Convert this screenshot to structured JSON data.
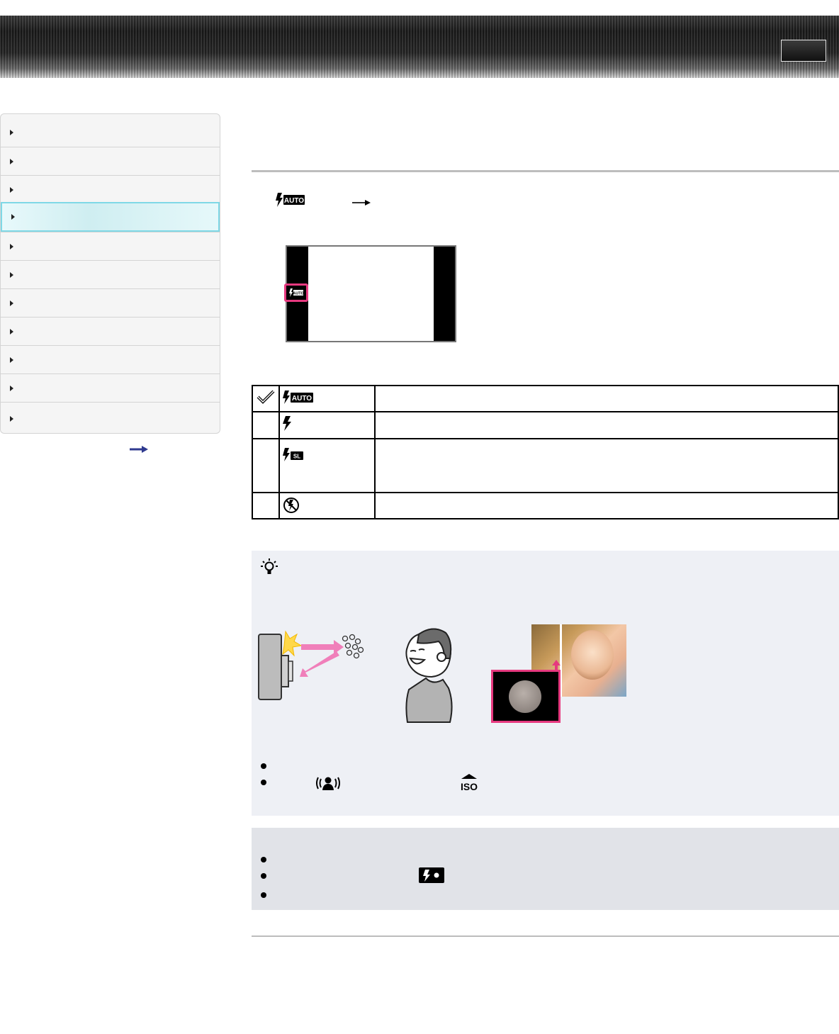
{
  "header": {
    "top_button_icon": "blank-button"
  },
  "sidebar": {
    "items": [
      {
        "label": "",
        "active": false
      },
      {
        "label": "",
        "active": false
      },
      {
        "label": "",
        "active": false
      },
      {
        "label": "",
        "active": true
      },
      {
        "label": "",
        "active": false
      },
      {
        "label": "",
        "active": false
      },
      {
        "label": "",
        "active": false
      },
      {
        "label": "",
        "active": false
      },
      {
        "label": "",
        "active": false
      },
      {
        "label": "",
        "active": false
      },
      {
        "label": "",
        "active": false
      }
    ],
    "footer_icon": "right-arrow-icon"
  },
  "step": {
    "icon_label": "AUTO",
    "arrow_icon": "right-arrow-icon"
  },
  "preview": {
    "icon_label": "AUTO",
    "highlight_color": "#e6397f"
  },
  "modes_table": {
    "rows": [
      {
        "selected": true,
        "icon": "flash-auto-icon",
        "icon_text": "AUTO"
      },
      {
        "selected": false,
        "icon": "flash-on-icon",
        "icon_text": ""
      },
      {
        "selected": false,
        "icon": "slow-sync-icon",
        "icon_text": "SL"
      },
      {
        "selected": false,
        "icon": "flash-off-icon",
        "icon_text": ""
      }
    ]
  },
  "tip": {
    "icon": "lightbulb-icon",
    "bullet_icons": [
      "anti-blur-icon",
      "iso-icon"
    ],
    "iso_text": "ISO",
    "images": [
      "flash-reflection-illustration",
      "smiling-boy-illustration",
      "orb-photo-example"
    ]
  },
  "note": {
    "icon": "flash-charging-icon"
  }
}
